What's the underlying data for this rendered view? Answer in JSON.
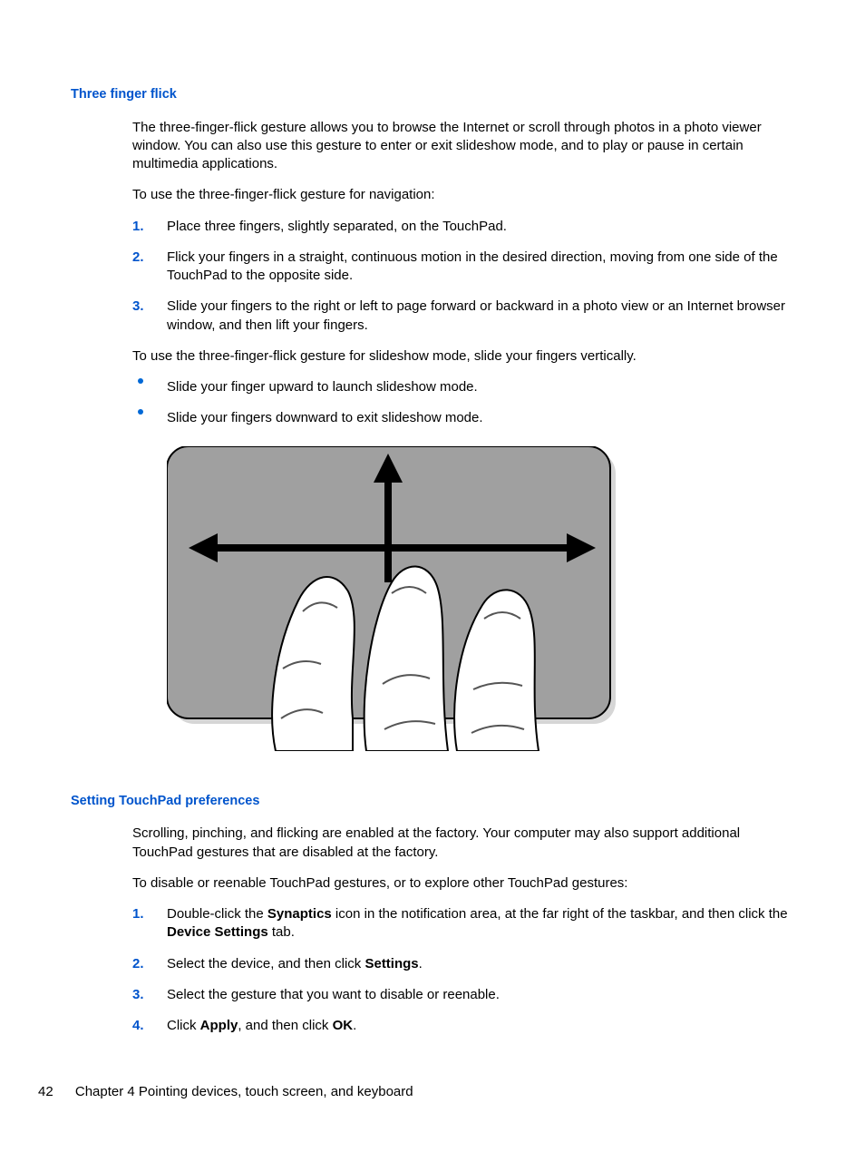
{
  "section1": {
    "heading": "Three finger flick",
    "intro": "The three-finger-flick gesture allows you to browse the Internet or scroll through photos in a photo viewer window. You can also use this gesture to enter or exit slideshow mode, and to play or pause in certain multimedia applications.",
    "lead1": "To use the three-finger-flick gesture for navigation:",
    "steps": [
      "Place three fingers, slightly separated, on the TouchPad.",
      "Flick your fingers in a straight, continuous motion in the desired direction, moving from one side of the TouchPad to the opposite side.",
      "Slide your fingers to the right or left to page forward or backward in a photo view or an Internet browser window, and then lift your fingers."
    ],
    "lead2": "To use the three-finger-flick gesture for slideshow mode, slide your fingers vertically.",
    "bullets": [
      "Slide your finger upward to launch slideshow mode.",
      "Slide your fingers downward to exit slideshow mode."
    ]
  },
  "section2": {
    "heading": "Setting TouchPad preferences",
    "intro": "Scrolling, pinching, and flicking are enabled at the factory. Your computer may also support additional TouchPad gestures that are disabled at the factory.",
    "lead": "To disable or reenable TouchPad gestures, or to explore other TouchPad gestures:",
    "steps_html": [
      "Double-click the <b>Synaptics</b> icon in the notification area, at the far right of the taskbar, and then click the <b>Device Settings</b> tab.",
      "Select the device, and then click <b>Settings</b>.",
      "Select the gesture that you want to disable or reenable.",
      "Click <b>Apply</b>, and then click <b>OK</b>."
    ]
  },
  "footer": {
    "page_number": "42",
    "chapter": "Chapter 4   Pointing devices, touch screen, and keyboard"
  }
}
